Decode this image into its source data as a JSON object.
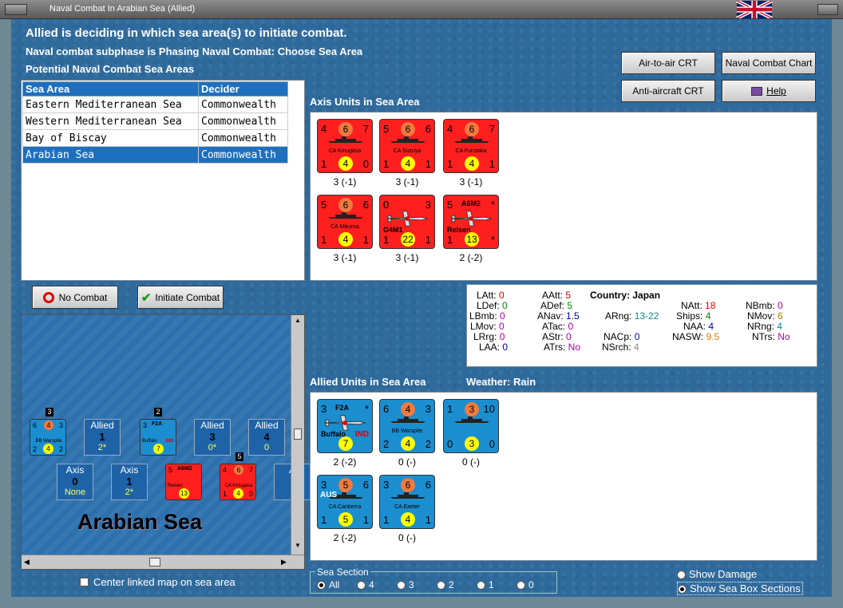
{
  "window": {
    "title": "Naval Combat In Arabian Sea (Allied)"
  },
  "header": {
    "line1": "Allied is deciding in which sea area(s) to initiate combat.",
    "line2": "Naval combat subphase is Phasing Naval Combat: Choose Sea Area",
    "line3": "Potential Naval Combat Sea Areas"
  },
  "buttons": {
    "air_to_air": "Air-to-air CRT",
    "naval_combat_chart": "Naval Combat Chart",
    "anti_aircraft": "Anti-aircraft CRT",
    "help": "Help",
    "no_combat": "No Combat",
    "initiate_combat": "Initiate Combat"
  },
  "sea_table": {
    "headers": [
      "Sea Area",
      "Decider"
    ],
    "rows": [
      [
        "Eastern Mediterranean Sea",
        "Commonwealth"
      ],
      [
        "Western Mediterranean Sea",
        "Commonwealth"
      ],
      [
        "Bay of Biscay",
        "Commonwealth"
      ],
      [
        "Arabian Sea",
        "Commonwealth"
      ]
    ],
    "selected": 3
  },
  "axis": {
    "title": "Axis Units in Sea Area",
    "units": [
      {
        "name": "CA Kinugasa",
        "tl": "4",
        "tc": "6",
        "tr": "7",
        "bl": "1",
        "bc": "4",
        "br": "0",
        "label": "3 (-1)"
      },
      {
        "name": "CA Suzuya",
        "tl": "5",
        "tc": "6",
        "tr": "6",
        "bl": "1",
        "bc": "4",
        "br": "1",
        "label": "3 (-1)"
      },
      {
        "name": "CA Furutaka",
        "tl": "4",
        "tc": "6",
        "tr": "7",
        "bl": "1",
        "bc": "4",
        "br": "1",
        "label": "3 (-1)"
      },
      {
        "name": "CA Mikuma",
        "tl": "5",
        "tc": "6",
        "tr": "6",
        "bl": "1",
        "bc": "4",
        "br": "1",
        "label": "3 (-1)"
      },
      {
        "name": "G4M1",
        "tl": "0",
        "tr": "3",
        "bl": "1",
        "bc": "22",
        "br": "1",
        "label": "3 (-1)"
      },
      {
        "name": "Reisen",
        "code": "A6M2",
        "tl": "5",
        "tr": "*",
        "bl": "1",
        "bc": "13",
        "br": "*",
        "label": "2 (-2)"
      }
    ]
  },
  "stats": {
    "country_label": "Country:",
    "country": "Japan",
    "LAtt": "0",
    "LDef": "0",
    "LBmb": "0",
    "LMov": "0",
    "LRrg": "0",
    "LAA": "0",
    "AAtt": "5",
    "ADef": "5",
    "ANav": "1.5",
    "ATac": "0",
    "AStr": "0",
    "ATrs": "No",
    "ARng": "13-22",
    "NACp": "0",
    "NSrch": "4",
    "NAtt": "18",
    "Ships": "4",
    "NAA": "4",
    "NASW": "9.5",
    "NBmb": "0",
    "NMov": "6",
    "NRng": "4",
    "NTrs": "No"
  },
  "allied": {
    "title": "Allied Units in Sea Area",
    "weather_label": "Weather:",
    "weather": "Rain",
    "units": [
      {
        "name": "Buffalo",
        "code": "F2A",
        "tag": "IND",
        "tl": "3",
        "tr": "*",
        "bc": "7",
        "label": "2 (-2)"
      },
      {
        "name": "BB Warspite",
        "tl": "6",
        "tc": "4",
        "tr": "3",
        "bl": "2",
        "bc": "4",
        "br": "2",
        "label": "0 (-)"
      },
      {
        "name": "",
        "tl": "1",
        "tc": "3",
        "tr": "10",
        "bl": "0",
        "bc": "3",
        "br": "0",
        "label": "0 (-)"
      },
      {
        "name": "CA Canberra",
        "tag": "AUS",
        "tl": "3",
        "tc": "5",
        "tr": "6",
        "bl": "1",
        "bc": "5",
        "br": "1",
        "label": "2 (-2)"
      },
      {
        "name": "CA Exeter",
        "tl": "3",
        "tc": "6",
        "tr": "6",
        "bl": "1",
        "bc": "4",
        "br": "1",
        "label": "0 (-)"
      }
    ]
  },
  "map": {
    "sea_name": "Arabian Sea",
    "boxes": [
      {
        "side": "Allied",
        "num": "1",
        "extra": "2*"
      },
      {
        "side": "Allied",
        "num": "3",
        "extra": "0*"
      },
      {
        "side": "Allied",
        "num": "4",
        "extra": "0"
      },
      {
        "side": "Axis",
        "num": "0",
        "extra": "None"
      },
      {
        "side": "Axis",
        "num": "1",
        "extra": "2*"
      },
      {
        "side": "A"
      }
    ],
    "stack_counts": [
      "3",
      "2",
      "5"
    ],
    "mini": [
      {
        "name": "BB Warspite",
        "tl": "6",
        "tc": "4",
        "tr": "3",
        "bl": "2",
        "bc": "4",
        "br": "2"
      },
      {
        "name": "Buffalo",
        "code": "F2A",
        "tag": "IND",
        "tl": "3",
        "bc": "7"
      },
      {
        "name": "Reisen",
        "code": "A6M2",
        "tl": "5",
        "bc": "13"
      },
      {
        "name": "CA Kinugasa",
        "tl": "4",
        "tc": "6",
        "tr": "7",
        "bl": "1",
        "bc": "4",
        "br": "0"
      }
    ]
  },
  "footer": {
    "center_map": "Center linked map on sea area",
    "sea_section_label": "Sea Section",
    "sections": [
      "All",
      "4",
      "3",
      "2",
      "1",
      "0"
    ],
    "show_damage": "Show Damage",
    "show_boxes": "Show Sea Box Sections"
  },
  "colors": {
    "axis_red": "#ff1f1f",
    "allied_blue": "#1b8ed0",
    "selection": "#1f6fbf"
  }
}
